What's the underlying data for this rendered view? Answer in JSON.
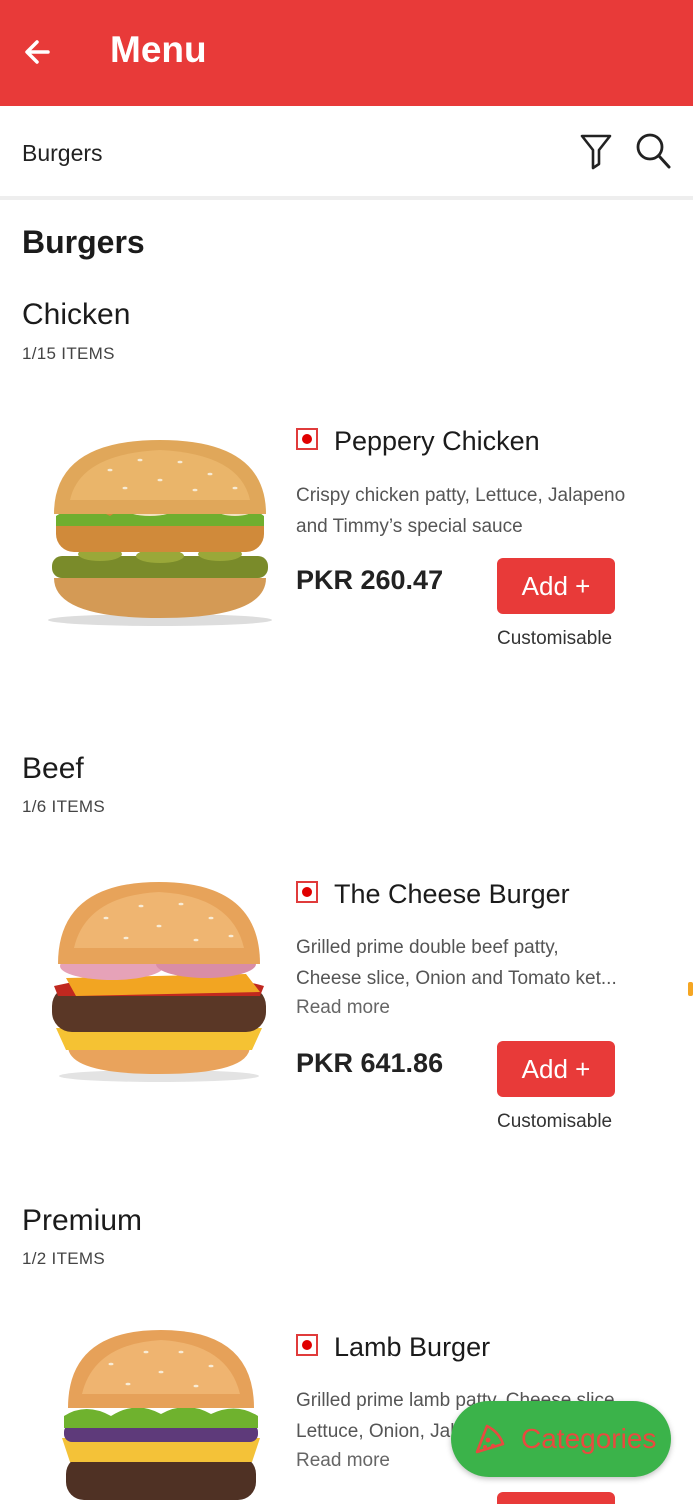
{
  "appbar": {
    "title": "Menu",
    "back_icon": "arrow-left-icon",
    "bg_color": "#e83a39"
  },
  "subbar": {
    "selected_category": "Burgers",
    "filter_icon": "filter-icon",
    "search_icon": "search-icon"
  },
  "section_title": "Burgers",
  "categories": [
    {
      "name": "Chicken",
      "count": "1/15 ITEMS",
      "item": {
        "name": "Peppery Chicken",
        "desc_lines": [
          "Crispy chicken patty, Lettuce, Jalapeno",
          "and Timmy’s special sauce"
        ],
        "read_more": "",
        "price": "PKR 260.47",
        "add_label": "Add +",
        "custom_label": "Customisable"
      }
    },
    {
      "name": "Beef",
      "count": "1/6 ITEMS",
      "item": {
        "name": "The Cheese Burger",
        "desc_lines": [
          "Grilled prime double beef patty,",
          "Cheese slice, Onion and Tomato ket..."
        ],
        "read_more": "Read more",
        "price": "PKR 641.86",
        "add_label": "Add +",
        "custom_label": "Customisable"
      }
    },
    {
      "name": "Premium",
      "count": "1/2 ITEMS",
      "item": {
        "name": "Lamb Burger",
        "desc_lines": [
          "Grilled prime lamb patty, Cheese slice,",
          "Lettuce, Onion, Jalapeno"
        ],
        "read_more": "Read more"
      }
    }
  ],
  "fab": {
    "label": "Categories",
    "icon": "pizza-slice-icon",
    "color": "#3bb34a"
  }
}
